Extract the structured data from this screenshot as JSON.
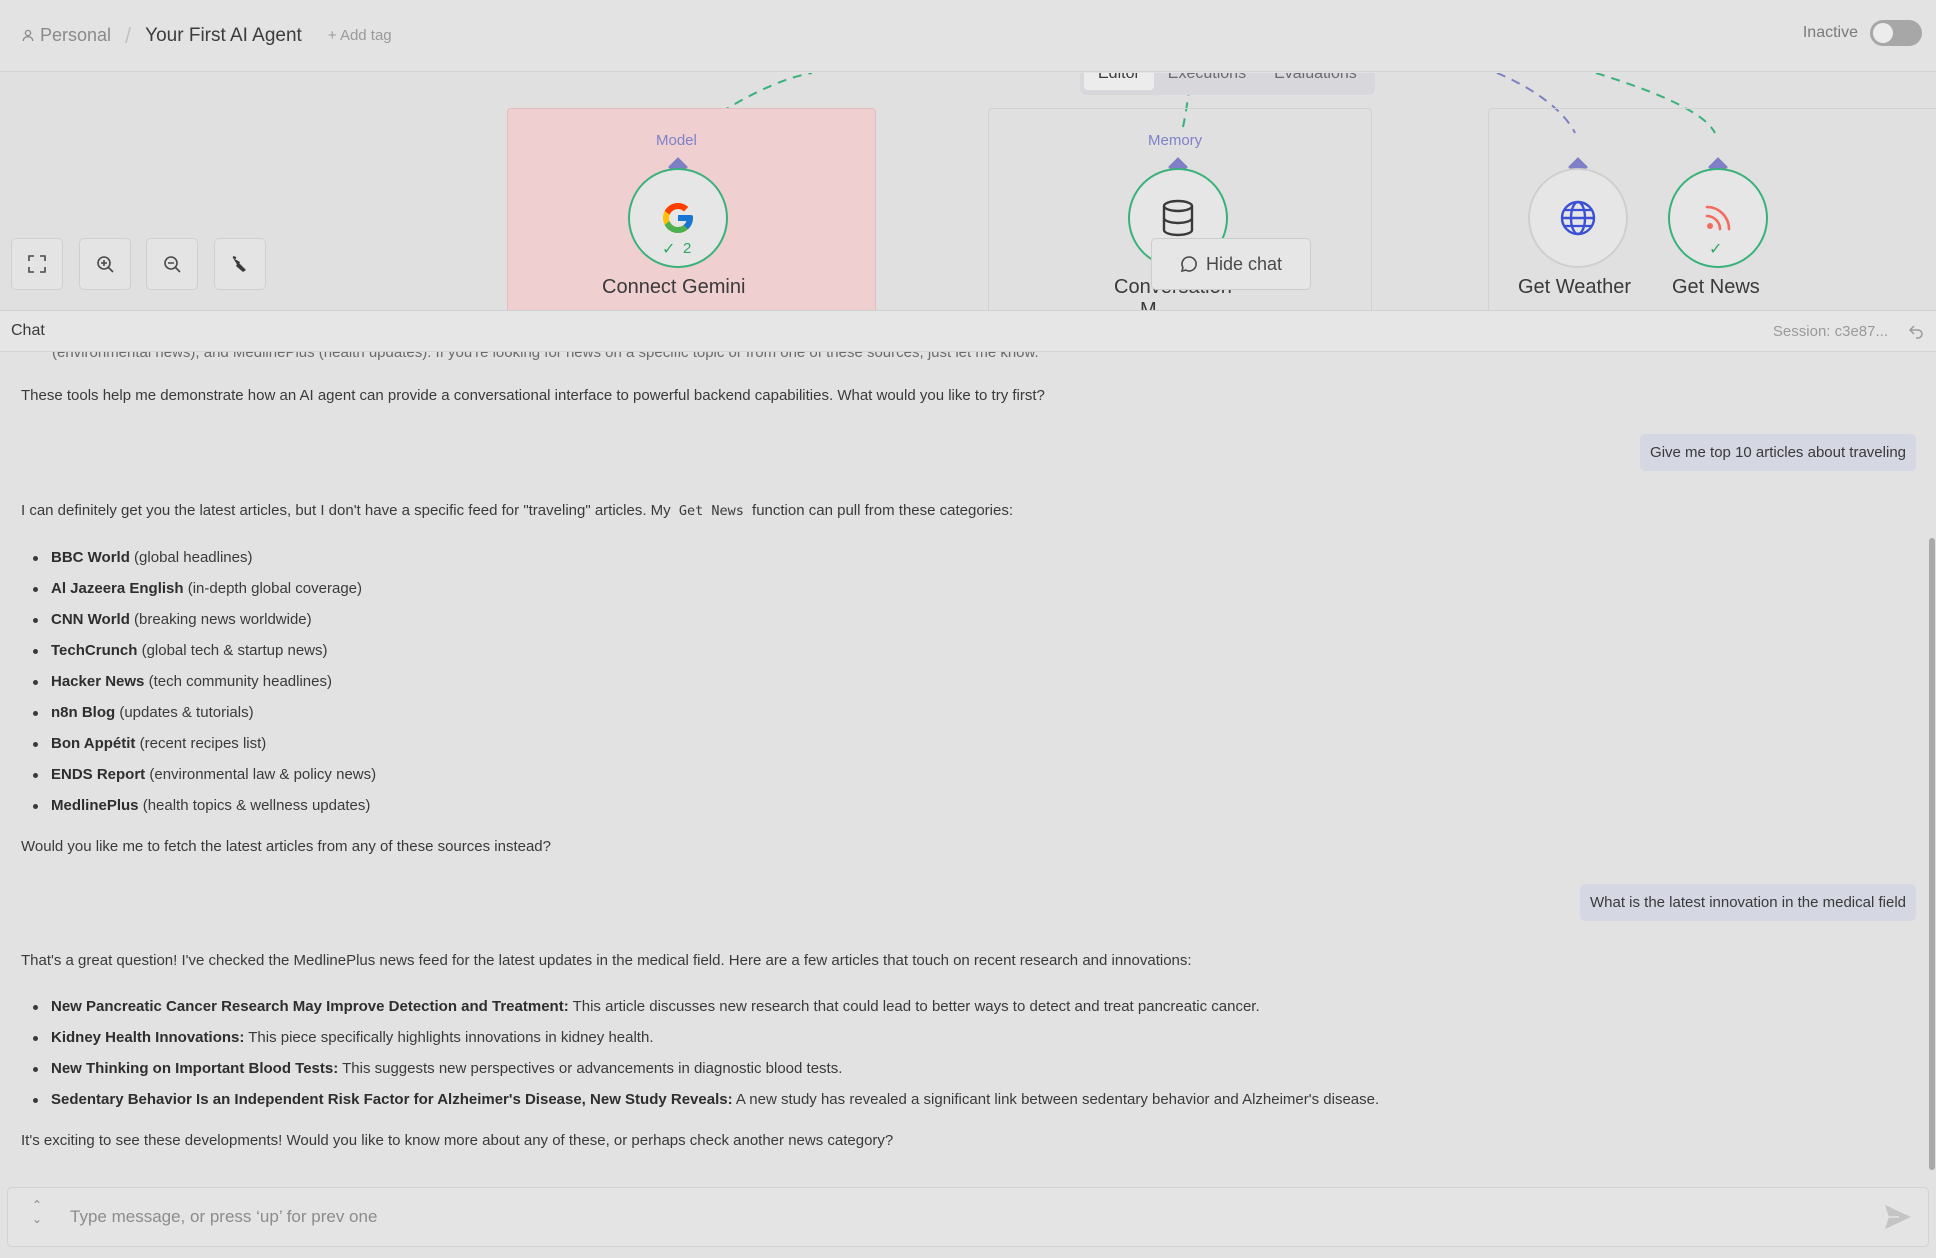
{
  "header": {
    "breadcrumb_personal": "Personal",
    "workflow_title": "Your First AI Agent",
    "add_tag": "+ Add tag",
    "status_label": "Inactive",
    "active": false
  },
  "tabs": [
    {
      "label": "Editor",
      "active": true
    },
    {
      "label": "Executions",
      "active": false
    },
    {
      "label": "Evaluations",
      "active": false
    }
  ],
  "nodes": {
    "model_port": "Model",
    "memory_port": "Memory",
    "gemini_title": "Connect Gemini",
    "gemini_runs": "2",
    "memory_title": "Conversation",
    "memory_title_clipped": "M",
    "weather_title": "Get Weather",
    "news_title": "Get News"
  },
  "hide_chat": "Hide chat",
  "chat_header": {
    "title": "Chat",
    "session": "Session: c3e87..."
  },
  "messages": {
    "clipped_top": "(environmental news), and MedlinePlus (health updates). If you're looking for news on a specific topic or from one of these sources, just let me know.",
    "intro_tail": "These tools help me demonstrate how an AI agent can provide a conversational interface to powerful backend capabilities. What would you like to try first?",
    "user_1": "Give me top 10 articles about traveling",
    "reply_1_pre": "I can definitely get you the latest articles, but I don't have a specific feed for \"traveling\" articles. My ",
    "reply_1_code": "Get News",
    "reply_1_post": " function can pull from these categories:",
    "sources": [
      {
        "name": "BBC World",
        "desc": " (global headlines)"
      },
      {
        "name": "Al Jazeera English",
        "desc": " (in-depth global coverage)"
      },
      {
        "name": "CNN World",
        "desc": " (breaking news worldwide)"
      },
      {
        "name": "TechCrunch",
        "desc": " (global tech & startup news)"
      },
      {
        "name": "Hacker News",
        "desc": " (tech community headlines)"
      },
      {
        "name": "n8n Blog",
        "desc": " (updates & tutorials)"
      },
      {
        "name": "Bon Appétit",
        "desc": " (recent recipes list)"
      },
      {
        "name": "ENDS Report",
        "desc": " (environmental law & policy news)"
      },
      {
        "name": "MedlinePlus",
        "desc": " (health topics & wellness updates)"
      }
    ],
    "reply_1_end": "Would you like me to fetch the latest articles from any of these sources instead?",
    "user_2": "What is the latest innovation in the medical field",
    "reply_2_intro": "That's a great question! I've checked the MedlinePlus news feed for the latest updates in the medical field. Here are a few articles that touch on recent research and innovations:",
    "articles": [
      {
        "title": "New Pancreatic Cancer Research May Improve Detection and Treatment:",
        "desc": " This article discusses new research that could lead to better ways to detect and treat pancreatic cancer."
      },
      {
        "title": "Kidney Health Innovations:",
        "desc": " This piece specifically highlights innovations in kidney health."
      },
      {
        "title": "New Thinking on Important Blood Tests:",
        "desc": " This suggests new perspectives or advancements in diagnostic blood tests."
      },
      {
        "title": "Sedentary Behavior Is an Independent Risk Factor for Alzheimer's Disease, New Study Reveals:",
        "desc": " A new study has revealed a significant link between sedentary behavior and Alzheimer's disease."
      }
    ],
    "reply_2_end": "It's exciting to see these developments! Would you like to know more about any of these, or perhaps check another news category?"
  },
  "input": {
    "placeholder": "Type message, or press ‘up’ for prev one",
    "value": ""
  },
  "colors": {
    "success": "#39b27a",
    "port": "#7d80c4",
    "error_panel": "#efcfd0",
    "user_bubble": "#d5d7e3"
  }
}
